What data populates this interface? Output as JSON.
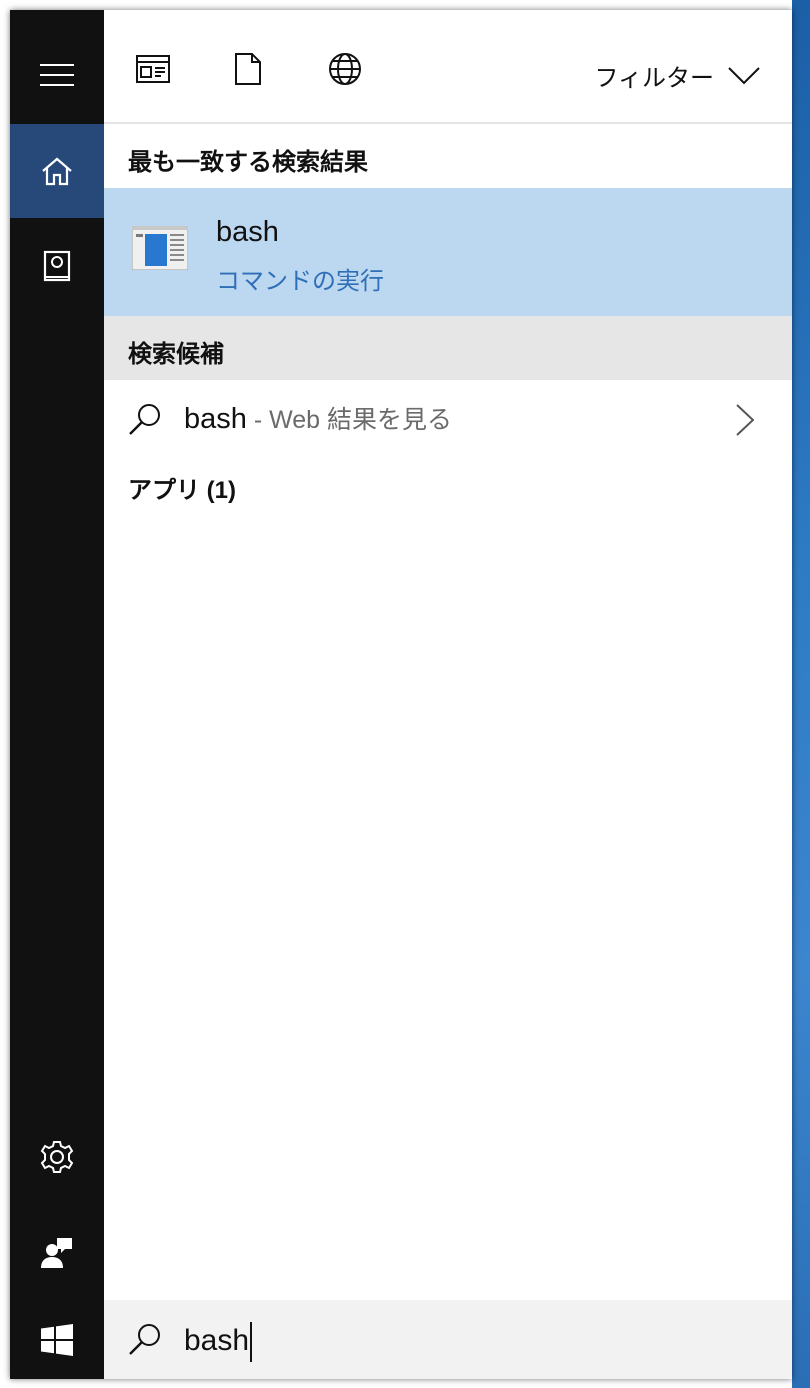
{
  "filter": {
    "label": "フィルター"
  },
  "best_match": {
    "heading": "最も一致する検索結果",
    "name": "bash",
    "subtitle": "コマンドの実行"
  },
  "suggestions": {
    "heading": "検索候補",
    "items": [
      {
        "query": "bash",
        "suffix": " - Web 結果を見る"
      }
    ]
  },
  "apps": {
    "heading": "アプリ (1)"
  },
  "search": {
    "value": "bash"
  },
  "colors": {
    "rail": "#111111",
    "rail_active": "#27497a",
    "best_match_bg": "#bcd7f0",
    "accent_text": "#2f6fb7"
  },
  "icons": [
    "hamburger-icon",
    "home-icon",
    "notebook-icon",
    "gear-icon",
    "feedback-icon",
    "windows-start-icon",
    "apps-icon",
    "documents-icon",
    "web-icon",
    "chevron-down-icon",
    "search-icon",
    "chevron-right-icon"
  ]
}
